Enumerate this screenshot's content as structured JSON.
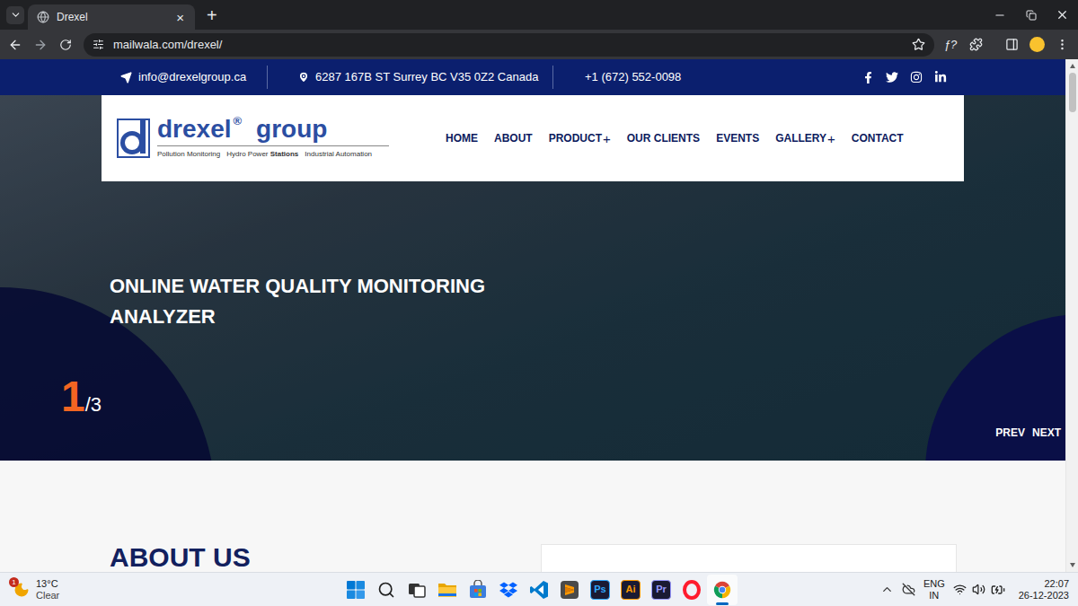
{
  "browser": {
    "tabs": [
      {
        "title": "Drexel",
        "selected": true,
        "close": "×"
      }
    ],
    "new_tab": "+",
    "url": "mailwala.com/drexel/",
    "bookmarked": false,
    "extension": "ƒ?"
  },
  "site": {
    "contact_bar": {
      "email": "info@drexelgroup.ca",
      "address": "6287 167B ST Surrey BC V35 0Z2 Canada",
      "phone": "+1 (672) 552-0098"
    },
    "logo": {
      "name": "drexel",
      "registered": "®",
      "suffix": "group",
      "tagline": [
        {
          "text": "Pollution Monitoring",
          "strong": ""
        },
        {
          "text": "Hydro Power",
          "strong": "Stations"
        },
        {
          "text": "Industrial Automation",
          "strong": ""
        }
      ]
    },
    "nav_expand_glyph": "+",
    "nav": [
      {
        "label": "HOME",
        "expandable": false
      },
      {
        "label": "ABOUT",
        "expandable": false
      },
      {
        "label": "PRODUCT",
        "expandable": true
      },
      {
        "label": "OUR CLIENTS",
        "expandable": false
      },
      {
        "label": "EVENTS",
        "expandable": false
      },
      {
        "label": "GALLERY",
        "expandable": true
      },
      {
        "label": "CONTACT",
        "expandable": false
      }
    ],
    "hero": {
      "title_lines": [
        "ONLINE WATER QUALITY MONITORING",
        "ANALYZER"
      ],
      "current": "1",
      "total": "/3",
      "prev": "PREV",
      "next": "NEXT"
    },
    "about": {
      "heading": "ABOUT US"
    }
  },
  "taskbar": {
    "weather": {
      "temp": "13°C",
      "condition": "Clear",
      "badge": "1"
    },
    "apps": [
      {
        "kind": "start",
        "label": "",
        "color": "",
        "active": false
      },
      {
        "kind": "search",
        "label": "",
        "color": "",
        "active": false
      },
      {
        "kind": "taskview",
        "label": "",
        "color": "",
        "active": false
      },
      {
        "kind": "explorer",
        "label": "",
        "color": "",
        "active": false
      },
      {
        "kind": "store",
        "label": "",
        "color": "",
        "active": false
      },
      {
        "kind": "dropbox",
        "label": "",
        "color": "",
        "active": false
      },
      {
        "kind": "vscode",
        "label": "",
        "color": "",
        "active": false
      },
      {
        "kind": "sublime",
        "label": "",
        "color": "",
        "active": false
      },
      {
        "kind": "adobe",
        "label": "Ps",
        "color": "#31a8ff",
        "active": false
      },
      {
        "kind": "adobe",
        "label": "Ai",
        "color": "#ff9a00",
        "active": false
      },
      {
        "kind": "adobe",
        "label": "Pr",
        "color": "#9999ff",
        "active": false
      },
      {
        "kind": "opera",
        "label": "",
        "color": "",
        "active": false
      },
      {
        "kind": "chrome",
        "label": "",
        "color": "",
        "active": true
      }
    ],
    "tray": {
      "lang": "ENG",
      "region": "IN",
      "time": "22:07",
      "date": "26-12-2023"
    }
  }
}
